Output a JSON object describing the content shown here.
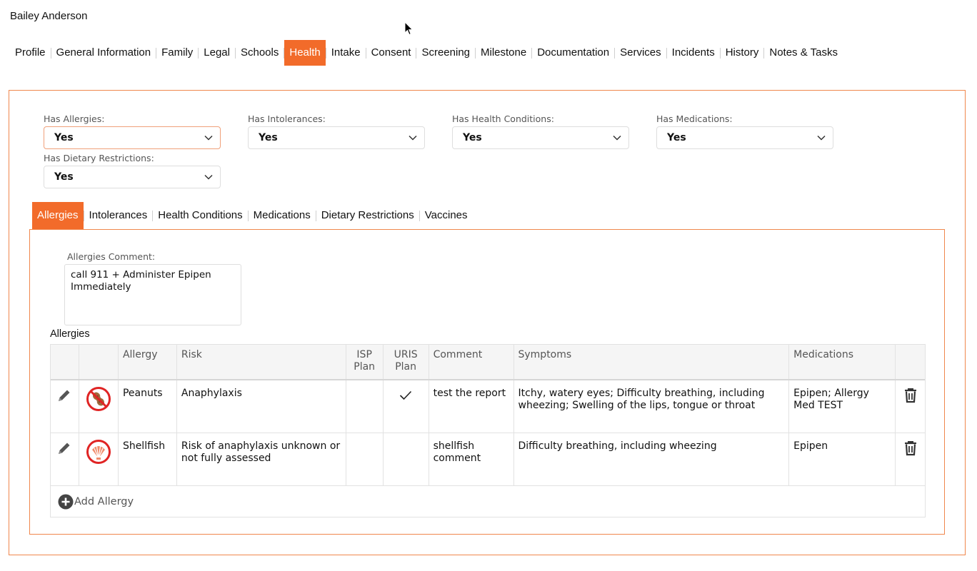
{
  "user": {
    "name": "Bailey Anderson"
  },
  "nav": {
    "items": [
      {
        "label": "Profile"
      },
      {
        "label": "General Information"
      },
      {
        "label": "Family"
      },
      {
        "label": "Legal"
      },
      {
        "label": "Schools"
      },
      {
        "label": "Health"
      },
      {
        "label": "Intake"
      },
      {
        "label": "Consent"
      },
      {
        "label": "Screening"
      },
      {
        "label": "Milestone"
      },
      {
        "label": "Documentation"
      },
      {
        "label": "Services"
      },
      {
        "label": "Incidents"
      },
      {
        "label": "History"
      },
      {
        "label": "Notes & Tasks"
      }
    ],
    "active": "Health"
  },
  "flags": {
    "allergies": {
      "label": "Has Allergies:",
      "value": "Yes"
    },
    "intolerances": {
      "label": "Has Intolerances:",
      "value": "Yes"
    },
    "conditions": {
      "label": "Has Health Conditions:",
      "value": "Yes"
    },
    "medications": {
      "label": "Has Medications:",
      "value": "Yes"
    },
    "dietary": {
      "label": "Has Dietary Restrictions:",
      "value": "Yes"
    }
  },
  "subtabs": {
    "items": [
      {
        "label": "Allergies"
      },
      {
        "label": "Intolerances"
      },
      {
        "label": "Health Conditions"
      },
      {
        "label": "Medications"
      },
      {
        "label": "Dietary Restrictions"
      },
      {
        "label": "Vaccines"
      }
    ],
    "active": "Allergies"
  },
  "allergies": {
    "comment_label": "Allergies Comment:",
    "comment": "call 911 + Administer Epipen\nImmediately",
    "table_title": "Allergies",
    "columns": {
      "allergy": "Allergy",
      "risk": "Risk",
      "isp": "ISP Plan",
      "uris": "URIS Plan",
      "comment": "Comment",
      "symptoms": "Symptoms",
      "medications": "Medications"
    },
    "rows": [
      {
        "icon": "peanut-icon",
        "allergy": "Peanuts",
        "risk": "Anaphylaxis",
        "isp": "",
        "uris_checked": true,
        "comment": "test the report",
        "symptoms": "Itchy, watery eyes; Difficulty breathing, including wheezing; Swelling of the lips, tongue or throat",
        "medications": "Epipen; Allergy Med TEST"
      },
      {
        "icon": "shellfish-icon",
        "allergy": "Shellfish",
        "risk": "Risk of anaphylaxis unknown or not fully assessed",
        "isp": "",
        "uris_checked": false,
        "comment": "shellfish comment",
        "symptoms": "Difficulty breathing, including wheezing",
        "medications": "Epipen"
      }
    ],
    "add_label": "Add Allergy"
  },
  "colors": {
    "accent": "#f26b2a",
    "panel_border": "#f0874d",
    "allergen_ring": "#e02424"
  }
}
